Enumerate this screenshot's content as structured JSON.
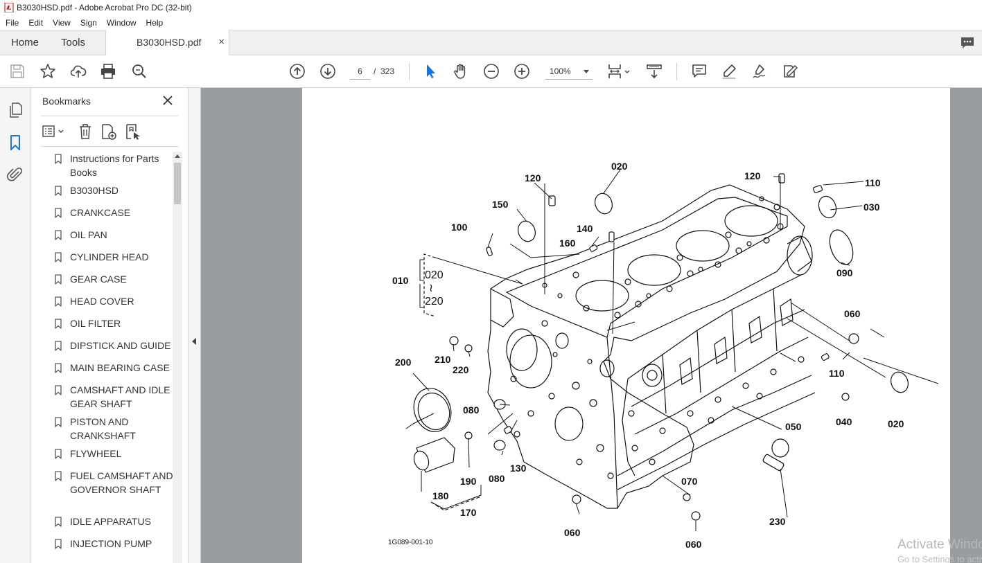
{
  "window": {
    "title": "B3030HSD.pdf - Adobe Acrobat Pro DC (32-bit)"
  },
  "menu": [
    "File",
    "Edit",
    "View",
    "Sign",
    "Window",
    "Help"
  ],
  "tabs": {
    "home": "Home",
    "tools": "Tools",
    "document": "B3030HSD.pdf",
    "close_glyph": "×"
  },
  "toolbar": {
    "current_page": "6",
    "page_separator": "/",
    "total_pages": "323",
    "zoom": "100%"
  },
  "bookmarks": {
    "title": "Bookmarks",
    "items": [
      "Instructions for Parts Books",
      "B3030HSD",
      "CRANKCASE",
      "OIL PAN",
      "CYLINDER HEAD",
      "GEAR CASE",
      "HEAD COVER",
      "OIL FILTER",
      "DIPSTICK AND GUIDE",
      "MAIN BEARING CASE",
      "CAMSHAFT AND IDLE GEAR SHAFT",
      "PISTON AND CRANKSHAFT",
      "FLYWHEEL",
      "FUEL CAMSHAFT AND GOVERNOR SHAFT",
      "IDLE APPARATUS",
      "INJECTION PUMP"
    ]
  },
  "diagram": {
    "labels": {
      "l020_top": "020",
      "l120_left": "120",
      "l120_right": "120",
      "l110_top": "110",
      "l030": "030",
      "l150": "150",
      "l100": "100",
      "l140": "140",
      "l160": "160",
      "l090": "090",
      "l010": "010",
      "l020_range": "020",
      "l220_range": "220",
      "l060_right": "060",
      "l110_right": "110",
      "l200": "200",
      "l210": "210",
      "l220": "220",
      "l080_a": "080",
      "l080_b": "080",
      "l130": "130",
      "l190": "190",
      "l180": "180",
      "l170": "170",
      "l050": "050",
      "l040": "040",
      "l020_right": "020",
      "l070": "070",
      "l060_bottom": "060",
      "l060_bottom2": "060",
      "l230": "230"
    },
    "range_glyph": "≀",
    "figure_code": "1G089-001-10"
  },
  "watermark": {
    "line1": "Activate Windows",
    "line2": "Go to Settings to activate Windows."
  },
  "colors": {
    "accent": "#1473e6",
    "panel_bg": "#f5f5f5",
    "doc_bg": "#999da2"
  }
}
